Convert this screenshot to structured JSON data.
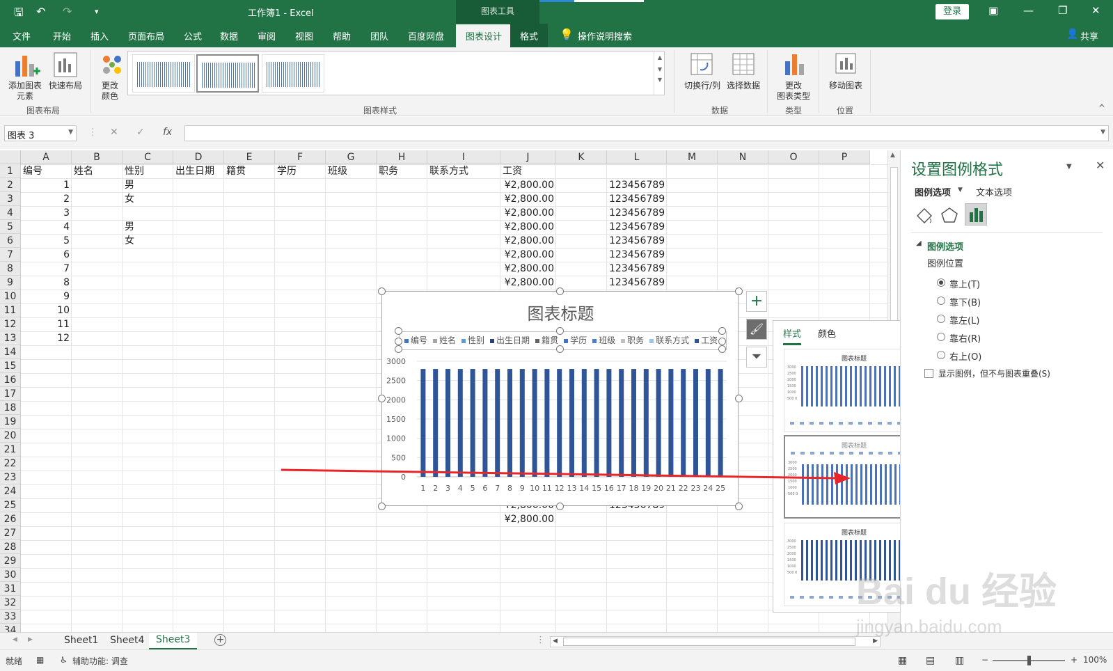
{
  "window": {
    "title": "工作簿1 - Excel",
    "context_tools": "图表工具",
    "login": "登录"
  },
  "colors": {
    "excel_green": "#217346",
    "bar_blue": "#4472c4",
    "bar_dark": "#2f5597",
    "arrow_red": "#e8262a"
  },
  "tabs": [
    "文件",
    "开始",
    "插入",
    "页面布局",
    "公式",
    "数据",
    "审阅",
    "视图",
    "帮助",
    "团队",
    "百度网盘",
    "图表设计",
    "格式"
  ],
  "active_tab": "图表设计",
  "search": "操作说明搜索",
  "share": "共享",
  "ribbon": {
    "add_element": "添加图表\n元素",
    "quick_layout": "快速布局",
    "change_color": "更改\n颜色",
    "switch_rowcol": "切换行/列",
    "select_data": "选择数据",
    "change_type": "更改\n图表类型",
    "move_chart": "移动图表",
    "groups": {
      "layout": "图表布局",
      "styles": "图表样式",
      "data": "数据",
      "type": "类型",
      "location": "位置"
    }
  },
  "namebox": "图表 3",
  "fx": "fx",
  "columns": [
    "A",
    "B",
    "C",
    "D",
    "E",
    "F",
    "G",
    "H",
    "I",
    "J",
    "K",
    "L",
    "M",
    "N",
    "O",
    "P"
  ],
  "rows": [
    "1",
    "2",
    "3",
    "4",
    "5",
    "6",
    "7",
    "8",
    "9",
    "10",
    "11",
    "12",
    "13",
    "14",
    "15",
    "16",
    "17",
    "18",
    "19",
    "20",
    "21",
    "22",
    "23",
    "24",
    "25",
    "26",
    "27",
    "28",
    "29",
    "30",
    "31",
    "32",
    "33",
    "34"
  ],
  "headers": [
    "编号",
    "姓名",
    "性别",
    "出生日期",
    "籍贯",
    "学历",
    "班级",
    "职务",
    "联系方式",
    "工资"
  ],
  "data_rows": [
    {
      "a": "1",
      "c": "男",
      "j": "¥2,800.00",
      "l": "123456789"
    },
    {
      "a": "2",
      "c": "女",
      "j": "¥2,800.00",
      "l": "123456789"
    },
    {
      "a": "3",
      "c": "",
      "j": "¥2,800.00",
      "l": "123456789"
    },
    {
      "a": "4",
      "c": "男",
      "j": "¥2,800.00",
      "l": "123456789"
    },
    {
      "a": "5",
      "c": "女",
      "j": "¥2,800.00",
      "l": "123456789"
    },
    {
      "a": "6",
      "c": "",
      "j": "¥2,800.00",
      "l": "123456789"
    },
    {
      "a": "7",
      "c": "",
      "j": "¥2,800.00",
      "l": "123456789"
    },
    {
      "a": "8",
      "c": "",
      "j": "¥2,800.00",
      "l": "123456789"
    },
    {
      "a": "9",
      "c": "",
      "j": "",
      "l": ""
    },
    {
      "a": "10",
      "c": "",
      "j": "",
      "l": ""
    },
    {
      "a": "11",
      "c": "",
      "j": "",
      "l": ""
    },
    {
      "a": "12",
      "c": "",
      "j": "",
      "l": ""
    }
  ],
  "partial_row25": {
    "j": "¥2,800.00",
    "l": "123456789"
  },
  "row26": {
    "j": "¥2,800.00"
  },
  "chart_data": {
    "type": "bar",
    "title": "图表标题",
    "legend": [
      "编号",
      "姓名",
      "性别",
      "出生日期",
      "籍贯",
      "学历",
      "班级",
      "职务",
      "联系方式",
      "工资"
    ],
    "legend_colors": [
      "#4472c4",
      "#a5a5a5",
      "#5b9bd5",
      "#264478",
      "#636363",
      "#4472c4",
      "#4a7bd0",
      "#c0c0c0",
      "#9dc3e6",
      "#2f5597"
    ],
    "categories": [
      "1",
      "2",
      "3",
      "4",
      "5",
      "6",
      "7",
      "8",
      "9",
      "10",
      "11",
      "12",
      "13",
      "14",
      "15",
      "16",
      "17",
      "18",
      "19",
      "20",
      "21",
      "22",
      "23",
      "24",
      "25"
    ],
    "values": [
      2800,
      2800,
      2800,
      2800,
      2800,
      2800,
      2800,
      2800,
      2800,
      2800,
      2800,
      2800,
      2800,
      2800,
      2800,
      2800,
      2800,
      2800,
      2800,
      2800,
      2800,
      2800,
      2800,
      2800,
      2800
    ],
    "y_ticks": [
      "0",
      "500",
      "1000",
      "1500",
      "2000",
      "2500",
      "3000"
    ],
    "ylim": [
      0,
      3000
    ]
  },
  "popup": {
    "tabs": [
      "样式",
      "颜色"
    ],
    "thumbs": [
      {
        "title": "图表标题",
        "ticks": "3000\n2500\n2000\n1500\n1000\n500\n0"
      },
      {
        "title": "图表标题",
        "ticks": "3000\n2500\n2000\n1500\n1000\n500\n0"
      },
      {
        "title": "图表标题",
        "ticks": "3000\n2500\n2000\n1500\n1000\n500\n0"
      }
    ]
  },
  "pane": {
    "title": "设置图例格式",
    "tabs": [
      "图例选项",
      "文本选项"
    ],
    "section": "图例选项",
    "subsection": "图例位置",
    "options": [
      "靠上(T)",
      "靠下(B)",
      "靠左(L)",
      "靠右(R)",
      "右上(O)"
    ],
    "selected": "靠上(T)",
    "overlap": "显示图例，但不与图表重叠(S)"
  },
  "sheets": [
    "Sheet1",
    "Sheet4",
    "Sheet3"
  ],
  "active_sheet": "Sheet3",
  "status": {
    "ready": "就绪",
    "accessibility": "辅助功能: 调查",
    "zoom": "100%"
  },
  "watermark": {
    "logo": "Bai du 经验",
    "url": "jingyan.baidu.com"
  }
}
